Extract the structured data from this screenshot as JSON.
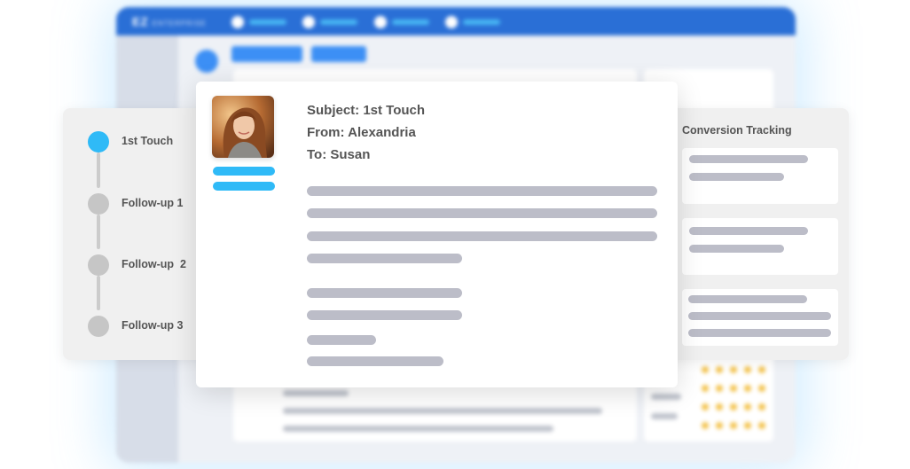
{
  "background_app": {
    "logo": "EZ",
    "logo_suffix": "ENTERPRISE"
  },
  "steps": [
    {
      "label": "1st Touch",
      "active": true
    },
    {
      "label": "Follow-up 1",
      "active": false
    },
    {
      "label": "Follow-up  2",
      "active": false
    },
    {
      "label": "Follow-up 3",
      "active": false
    }
  ],
  "email": {
    "subject": "Subject: 1st Touch",
    "from": "From: Alexandria",
    "to": "To: Susan"
  },
  "conversion": {
    "title": "Conversion Tracking"
  },
  "colors": {
    "accent": "#2fbaf7",
    "topbar": "#2a6fd6",
    "placeholder_line": "#bcbdc8",
    "star": "#f3c24b"
  }
}
